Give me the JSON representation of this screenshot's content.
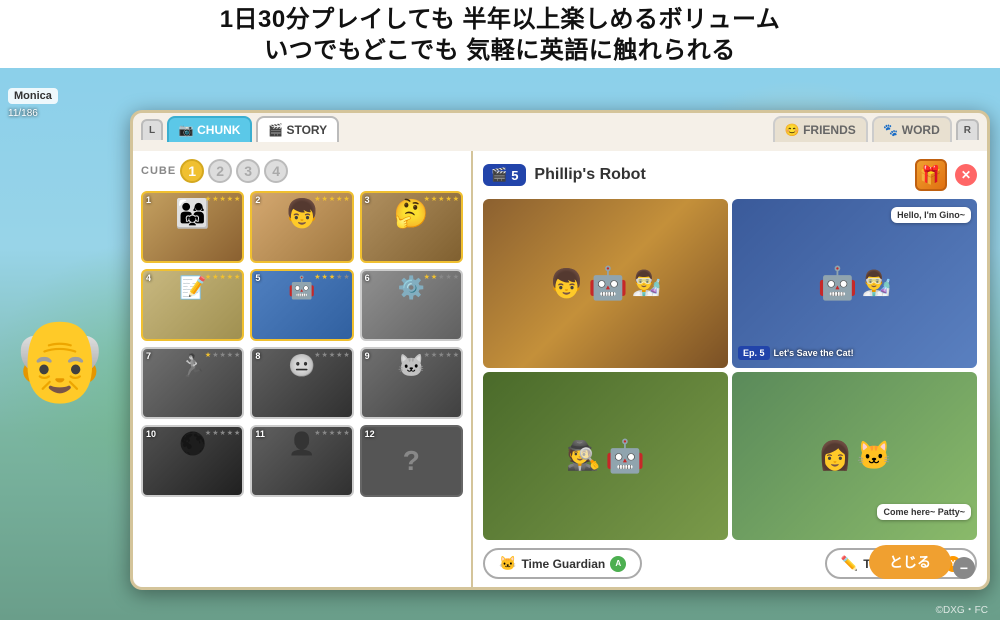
{
  "banner": {
    "line1": "1日30分プレイしても 半年以上楽しめるボリューム",
    "line2": "いつでもどこでも 気軽に英語に触れられる"
  },
  "player": {
    "name": "Monica",
    "progress": "11/186"
  },
  "tabs": {
    "left_button": "L",
    "right_button": "R",
    "chunk_label": "CHUNK",
    "story_label": "STORY",
    "friends_label": "FRIENDS",
    "word_label": "WORD"
  },
  "cube": {
    "label": "CUBE",
    "numbers": [
      "1",
      "2",
      "3",
      "4"
    ]
  },
  "episodes": [
    {
      "number": "1",
      "stars": 5,
      "max_stars": 5,
      "theme": "ep-1",
      "completed": true
    },
    {
      "number": "2",
      "stars": 5,
      "max_stars": 5,
      "theme": "ep-2",
      "completed": true
    },
    {
      "number": "3",
      "stars": 5,
      "max_stars": 5,
      "theme": "ep-3",
      "completed": true
    },
    {
      "number": "4",
      "stars": 5,
      "max_stars": 5,
      "theme": "ep-4",
      "completed": true
    },
    {
      "number": "5",
      "stars": 3,
      "max_stars": 5,
      "theme": "ep-5",
      "completed": true
    },
    {
      "number": "6",
      "stars": 3,
      "max_stars": 5,
      "theme": "ep-6",
      "completed": true
    },
    {
      "number": "7",
      "stars": 1,
      "max_stars": 5,
      "theme": "ep-7",
      "completed": false
    },
    {
      "number": "8",
      "stars": 0,
      "max_stars": 5,
      "theme": "ep-8",
      "completed": false
    },
    {
      "number": "9",
      "stars": 0,
      "max_stars": 5,
      "theme": "ep-9",
      "completed": false
    },
    {
      "number": "10",
      "stars": 0,
      "max_stars": 5,
      "theme": "ep-10",
      "completed": false
    },
    {
      "number": "11",
      "stars": 0,
      "max_stars": 5,
      "theme": "ep-11",
      "completed": false
    },
    {
      "number": "12",
      "stars": 0,
      "max_stars": 5,
      "theme": "ep-12",
      "locked": true
    }
  ],
  "story": {
    "episode_number": "5",
    "title": "Phillip's Robot",
    "scene_top_left_label": "",
    "scene_ep_badge": "Ep. 5",
    "scene_ep_text": "Let's Save the Cat!",
    "speech1": "Hello, I'm Gino~",
    "speech2": "Come here~\nPatty~"
  },
  "buttons": {
    "time_guardian": "Time Guardian",
    "time_guardian_badge": "A",
    "travel_report": "Travel Report",
    "travel_report_badge": "Y",
    "close": "とじる"
  },
  "copyright": "©DXG・FC"
}
